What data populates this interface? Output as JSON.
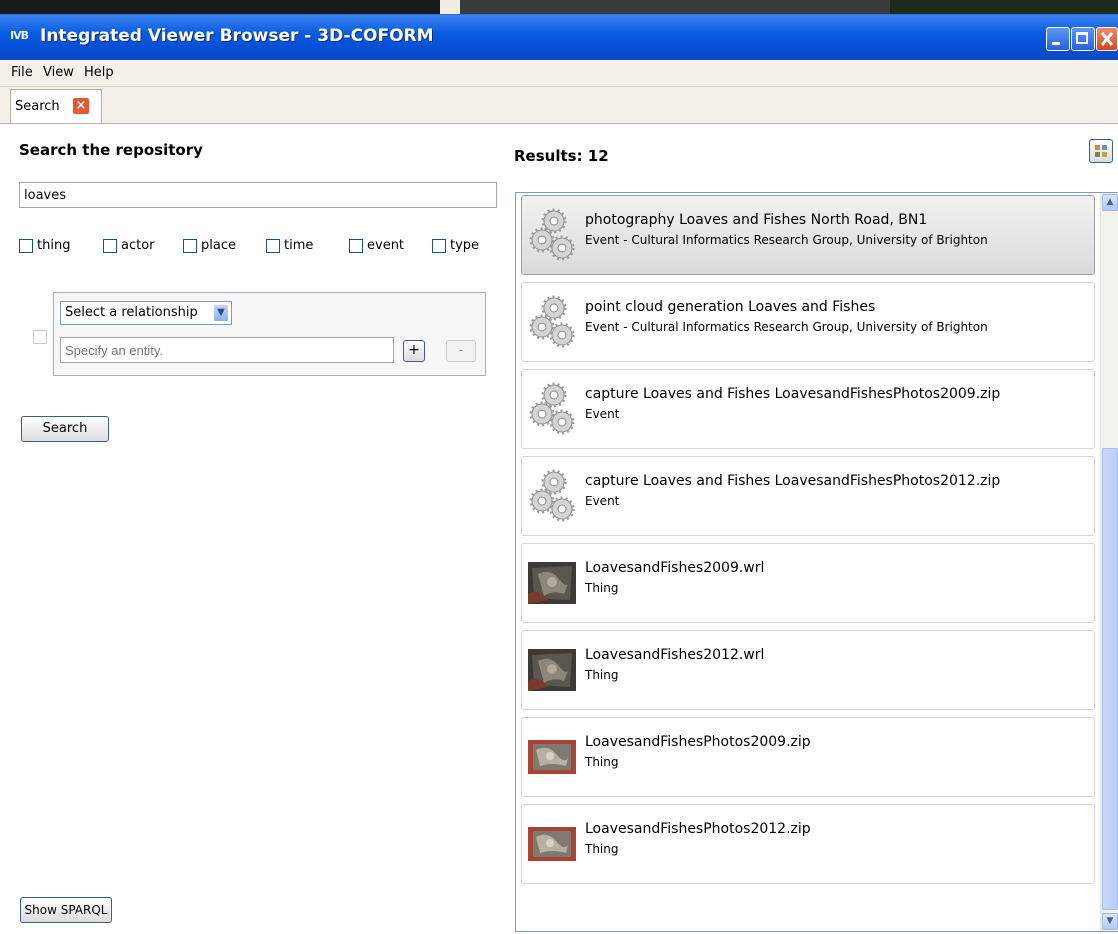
{
  "window": {
    "app_icon": "IVB",
    "title": "Integrated Viewer Browser - 3D-COFORM"
  },
  "menu": [
    {
      "label": "File"
    },
    {
      "label": "View"
    },
    {
      "label": "Help"
    }
  ],
  "tab": {
    "label": "Search",
    "close_glyph": "×"
  },
  "search": {
    "heading": "Search the repository",
    "query": "loaves",
    "filters": [
      {
        "label": "thing"
      },
      {
        "label": "actor"
      },
      {
        "label": "place"
      },
      {
        "label": "time"
      },
      {
        "label": "event"
      },
      {
        "label": "type"
      }
    ],
    "relationship_select": "Select a relationship",
    "entity_placeholder": "Specify an entity.",
    "add_label": "+",
    "remove_label": "-",
    "search_button": "Search",
    "sparql_button": "Show SPARQL"
  },
  "results": {
    "label": "Results: 12",
    "items": [
      {
        "title": "photography  Loaves and Fishes North Road, BN1",
        "subtitle": "Event - Cultural Informatics Research Group, University of Brighton",
        "icon": "gears-icon"
      },
      {
        "title": "point cloud generation Loaves and Fishes",
        "subtitle": "Event - Cultural Informatics Research Group, University of Brighton",
        "icon": "gears-icon"
      },
      {
        "title": "capture Loaves and Fishes LoavesandFishesPhotos2009.zip",
        "subtitle": "Event",
        "icon": "gears-icon"
      },
      {
        "title": "capture Loaves and Fishes LoavesandFishesPhotos2012.zip",
        "subtitle": "Event",
        "icon": "gears-icon"
      },
      {
        "title": "LoavesandFishes2009.wrl",
        "subtitle": "Thing",
        "icon": "model-thumbnail"
      },
      {
        "title": "LoavesandFishes2012.wrl",
        "subtitle": "Thing",
        "icon": "model-thumbnail"
      },
      {
        "title": "LoavesandFishesPhotos2009.zip",
        "subtitle": "Thing",
        "icon": "photo-thumbnail"
      },
      {
        "title": "LoavesandFishesPhotos2012.zip",
        "subtitle": "Thing",
        "icon": "photo-thumbnail"
      }
    ]
  },
  "colors": {
    "titlebar": "#0a5ce0",
    "close_button": "#e8572f",
    "selection": "#dadada"
  }
}
